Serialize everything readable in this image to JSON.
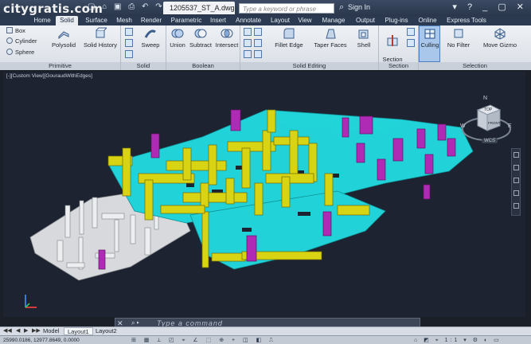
{
  "watermark": "citygratis.com",
  "quick_access": "▢ ⌂ ▣ ⎙ ↶ ↷ ▾",
  "file_name": "1205537_ST_A.dwg",
  "search": {
    "placeholder": "Type a keyword or phrase"
  },
  "sign_in": "Sign In",
  "window_controls": "▾ ? _ ▢ ✕",
  "tabs": [
    "Home",
    "Solid",
    "Surface",
    "Mesh",
    "Render",
    "Parametric",
    "Insert",
    "Annotate",
    "Layout",
    "View",
    "Manage",
    "Output",
    "Plug-ins",
    "Online",
    "Express Tools"
  ],
  "active_tab": "Solid",
  "ribbon": {
    "primitive": {
      "label": "Primitive",
      "box": "Box",
      "cylinder": "Cylinder",
      "sphere": "Sphere",
      "polysolid": "Polysolid",
      "solid_history": "Solid History"
    },
    "solid": {
      "label": "Solid",
      "sweep": "Sweep"
    },
    "boolean": {
      "label": "Boolean",
      "union": "Union",
      "subtract": "Subtract",
      "intersect": "Intersect"
    },
    "solid_editing": {
      "label": "Solid Editing",
      "fillet_edge": "Fillet Edge",
      "taper_faces": "Taper Faces",
      "shell": "Shell"
    },
    "section": {
      "label": "Section",
      "section_plane": "Section\nPlane",
      "culling": "Culling",
      "no_filter": "No Filter",
      "move_gizmo": "Move Gizmo"
    },
    "selection": {
      "label": "Selection"
    }
  },
  "viewport": {
    "label": "[-][Custom View][GouraudWithEdges]",
    "viewcube": {
      "top": "TOP",
      "front": "FRONT",
      "n": "N",
      "e": "E",
      "s": "S",
      "w": "W"
    },
    "wcs": "WCS",
    "colors": {
      "background": "#1d2330",
      "floor": "#21d3d8",
      "wall": "#d8d413",
      "column": "#b02bb5",
      "existing": "#d7d9dc"
    }
  },
  "command": {
    "close": "✕",
    "icons": "⌕ ▸",
    "placeholder": "Type a command"
  },
  "layouts": {
    "arrows": [
      "◀◀",
      "◀",
      "▶",
      "▶▶"
    ],
    "tabs": [
      "Model",
      "Layout1",
      "Layout2"
    ],
    "active": "Layout1"
  },
  "status": {
    "coords": "25990.0186, 12977.8649, 0.0000",
    "icons": "⊞ ▦ ⟂ ◰ ⌖ ∠ ⬚ ⊕ + ◫ ◧ ⎍",
    "right": "⌂ ◩ ⌖ 1:1 ▾ ⚙ ◐ ▭"
  }
}
